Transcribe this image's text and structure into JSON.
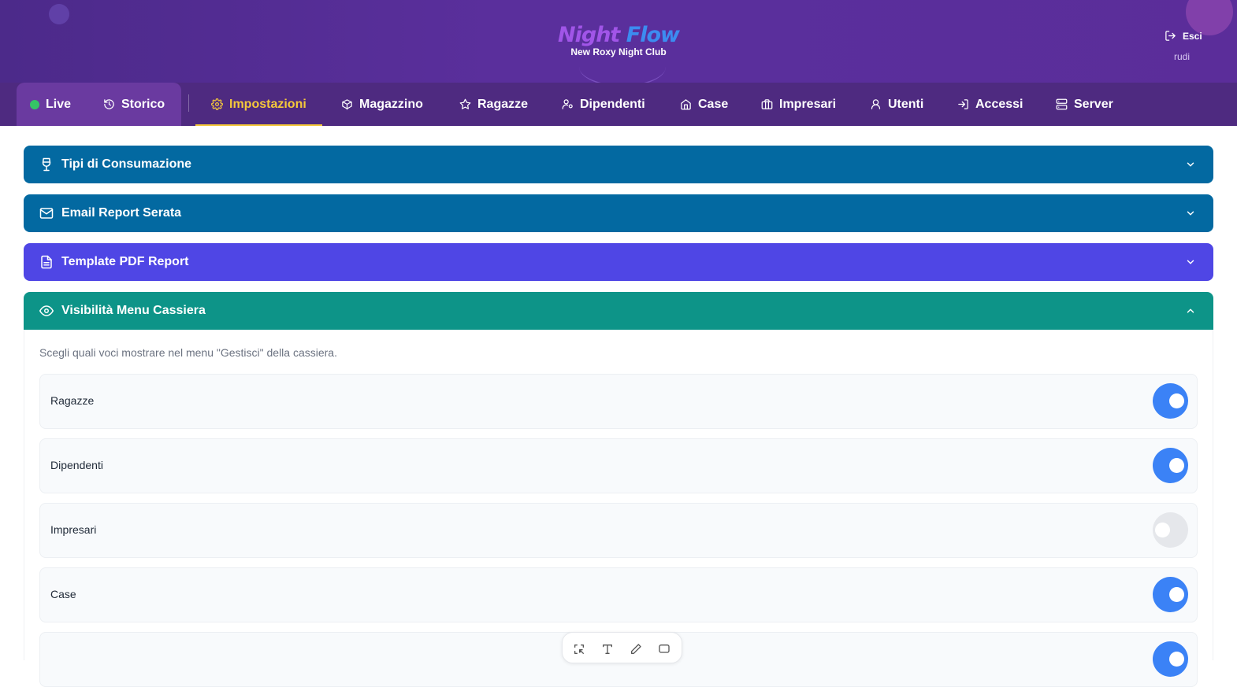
{
  "app": {
    "title_part1": "Night",
    "title_part2": "Flow",
    "subtitle": "New Roxy Night Club",
    "logout_label": "Esci",
    "username": "rudi"
  },
  "nav": {
    "items": [
      {
        "label": "Live",
        "icon": "live-dot"
      },
      {
        "label": "Storico",
        "icon": "history-icon"
      },
      {
        "label": "Impostazioni",
        "icon": "gear-icon",
        "active": true
      },
      {
        "label": "Magazzino",
        "icon": "box-icon"
      },
      {
        "label": "Ragazze",
        "icon": "star-icon"
      },
      {
        "label": "Dipendenti",
        "icon": "user-key-icon"
      },
      {
        "label": "Case",
        "icon": "house-icon"
      },
      {
        "label": "Impresari",
        "icon": "briefcase-icon"
      },
      {
        "label": "Utenti",
        "icon": "users-icon"
      },
      {
        "label": "Accessi",
        "icon": "login-icon"
      },
      {
        "label": "Server",
        "icon": "server-icon"
      }
    ]
  },
  "sections": [
    {
      "title": "Tipi di Consumazione",
      "icon": "wine-glass-icon",
      "expanded": false
    },
    {
      "title": "Email Report Serata",
      "icon": "mail-icon",
      "expanded": false
    },
    {
      "title": "Template PDF Report",
      "icon": "file-text-icon",
      "expanded": false
    },
    {
      "title": "Visibilità Menu Cassiera",
      "icon": "eye-icon",
      "expanded": true
    }
  ],
  "visibility": {
    "description": "Scegli quali voci mostrare nel menu \"Gestisci\" della cassiera.",
    "items": [
      {
        "label": "Ragazze",
        "enabled": true
      },
      {
        "label": "Dipendenti",
        "enabled": true
      },
      {
        "label": "Impresari",
        "enabled": false
      },
      {
        "label": "Case",
        "enabled": true
      },
      {
        "label": "",
        "enabled": true
      }
    ]
  },
  "colors": {
    "header": "#5a2f9c",
    "nav": "#4e2a80",
    "active_tab": "#f5c83a",
    "section_blue": "#0369a1",
    "section_indigo": "#4f46e5",
    "section_teal": "#0d9488",
    "toggle_on": "#3b82f6",
    "toggle_off": "#e5e7eb"
  }
}
